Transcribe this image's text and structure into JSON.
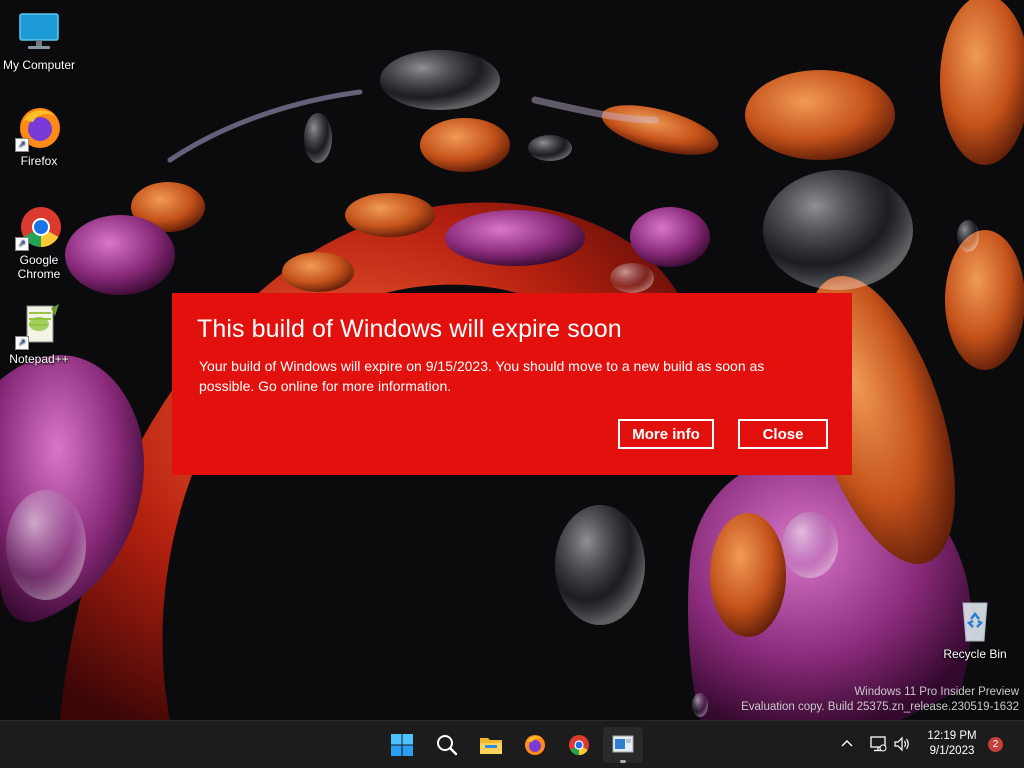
{
  "desktop": {
    "icons": [
      {
        "label": "My Computer"
      },
      {
        "label": "Firefox"
      },
      {
        "label": "Google Chrome"
      },
      {
        "label": "Notepad++"
      },
      {
        "label": "Recycle Bin"
      }
    ],
    "watermark": {
      "line1": "Windows 11 Pro Insider Preview",
      "line2": "Evaluation copy. Build 25375.zn_release.230519-1632"
    }
  },
  "dialog": {
    "title": "This build of Windows will expire soon",
    "message": "Your build of Windows will expire on 9/15/2023. You should move to a new build as soon as possible. Go online for more information.",
    "more_info_label": "More info",
    "close_label": "Close",
    "background_color": "#e3110d"
  },
  "taskbar": {
    "apps": [
      "start-icon",
      "search-icon",
      "file-explorer-icon",
      "firefox-icon",
      "chrome-icon",
      "remote-desktop-icon"
    ],
    "clock": {
      "time": "12:19 PM",
      "date": "9/1/2023"
    },
    "notification_count": "2"
  }
}
